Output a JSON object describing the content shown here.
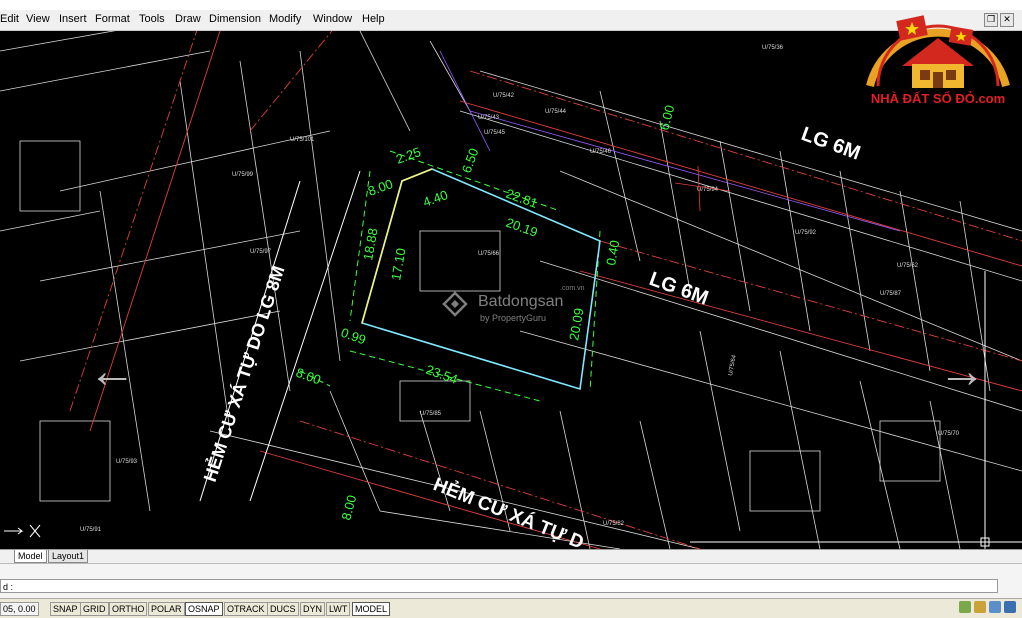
{
  "menu": {
    "items": [
      "Edit",
      "View",
      "Insert",
      "Format",
      "Tools",
      "Draw",
      "Dimension",
      "Modify",
      "Window",
      "Help"
    ]
  },
  "window_buttons": {
    "restore": "❐",
    "close": "✕"
  },
  "drawing": {
    "streets": {
      "lg6m_top": "LG 6M",
      "lg6m_mid": "LG 6M",
      "hem_left": "HẺM CƯ XÁ TỰ DO LG 8M",
      "hem_bottom": "HẺM CƯ XÁ TỰ D"
    },
    "dimensions": [
      "2.25",
      "8.00",
      "4.40",
      "6.50",
      "22.81",
      "20.19",
      "18.88",
      "17.10",
      "0.40",
      "20.09",
      "0.99",
      "23.54",
      "8.00",
      "6.00",
      "8.00"
    ],
    "lot_labels": [
      "U/75/36",
      "U/75/42",
      "U/75/43",
      "U/75/44",
      "U/75/45",
      "U/75/46",
      "U/75/101",
      "U/75/99",
      "U/75/97",
      "U/75/94",
      "U/75/66",
      "U/75/85",
      "U/75/93",
      "U/75/91",
      "U/75/82",
      "U/75/92",
      "U/75/70",
      "U/75/87",
      "U/75/62",
      "U/75/64"
    ],
    "colors": {
      "lot_outline": "#7fe8ff",
      "dimension": "#39ff3c",
      "street": "#ffffff",
      "grid": "#ffffff",
      "road_red": "#e0403a",
      "yellow": "#f4f07a"
    }
  },
  "watermark": {
    "name": "Batdongsan",
    "sub": "by PropertyGuru",
    "domain": ".com.vn"
  },
  "navigation": {
    "prev_icon": "arrow-left",
    "next_icon": "arrow-right",
    "prev_glyph": "←",
    "next_glyph": "→"
  },
  "logo": {
    "text": "NHÀ ĐẤT SỔ ĐỎ.com"
  },
  "tabs": [
    "Model",
    "Layout1"
  ],
  "command": {
    "history": "",
    "input": "d :"
  },
  "status": {
    "coords": "05, 0.00",
    "toggles": [
      {
        "label": "SNAP",
        "on": false
      },
      {
        "label": "GRID",
        "on": false
      },
      {
        "label": "ORTHO",
        "on": false
      },
      {
        "label": "POLAR",
        "on": false
      },
      {
        "label": "OSNAP",
        "on": true
      },
      {
        "label": "OTRACK",
        "on": false
      },
      {
        "label": "DUCS",
        "on": false
      },
      {
        "label": "DYN",
        "on": false
      },
      {
        "label": "LWT",
        "on": false
      },
      {
        "label": "MODEL",
        "on": true
      }
    ]
  }
}
